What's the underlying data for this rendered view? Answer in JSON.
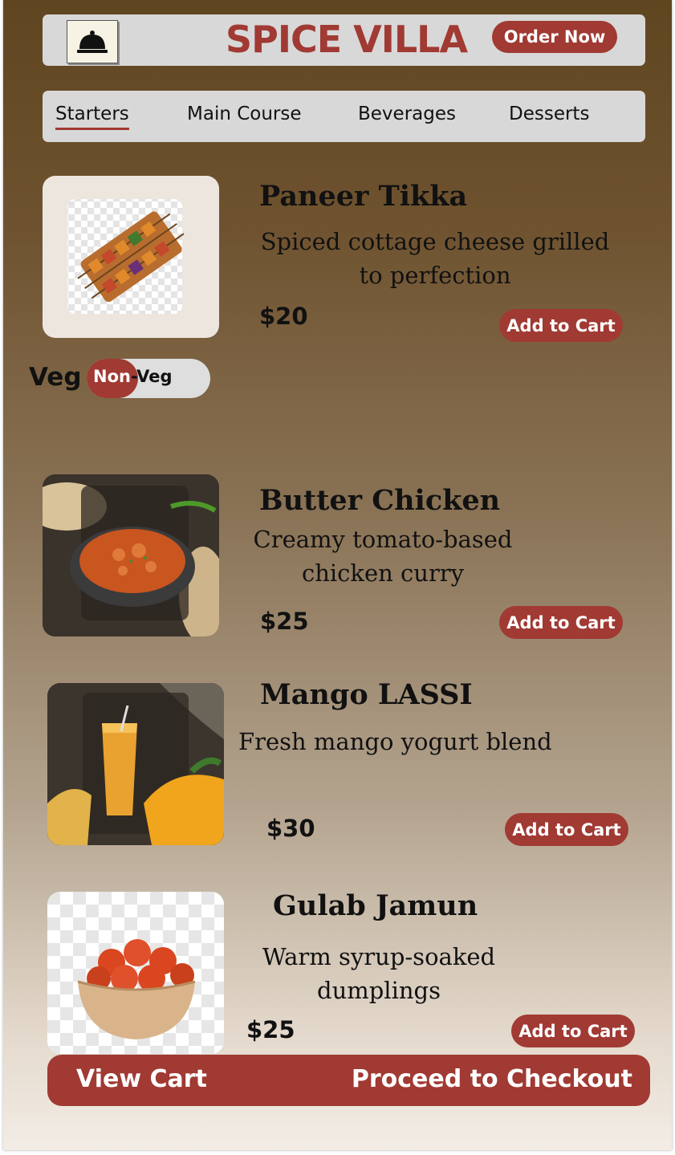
{
  "header": {
    "brand": "SPICE VILLA",
    "order_button": "Order Now",
    "logo_icon": "cloche-icon"
  },
  "tabs": [
    {
      "label": "Starters",
      "active": true
    },
    {
      "label": "Main Course",
      "active": false
    },
    {
      "label": "Beverages",
      "active": false
    },
    {
      "label": "Desserts",
      "active": false
    }
  ],
  "filter": {
    "veg_label": "Veg",
    "toggle_on": "Non",
    "toggle_rest": "-Veg"
  },
  "menu": [
    {
      "name": "Paneer Tikka",
      "description": "Spiced cottage cheese grilled to perfection",
      "price": "$20",
      "button": "Add to Cart",
      "image_icon": "paneer-tikka-image"
    },
    {
      "name": "Butter Chicken",
      "description": "Creamy tomato-based chicken curry",
      "price": "$25",
      "button": "Add to Cart",
      "image_icon": "butter-chicken-image"
    },
    {
      "name": "Mango LASSI",
      "description": "Fresh mango yogurt blend",
      "price": "$30",
      "button": "Add to Cart",
      "image_icon": "mango-lassi-image"
    },
    {
      "name": "Gulab Jamun",
      "description": "Warm syrup-soaked dumplings",
      "price": "$25",
      "button": "Add to Cart",
      "image_icon": "gulab-jamun-image"
    }
  ],
  "footer": {
    "view_cart": "View Cart",
    "checkout": "Proceed to Checkout"
  },
  "colors": {
    "accent": "#a03a33",
    "panel": "#d8d8d8"
  }
}
